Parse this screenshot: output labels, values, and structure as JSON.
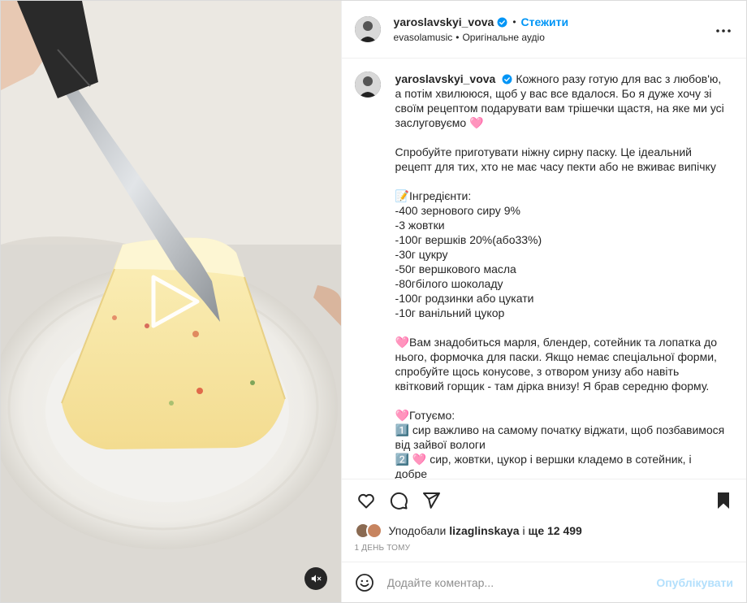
{
  "header": {
    "username": "yaroslavskyi_vova",
    "separator": "•",
    "follow_label": "Стежити",
    "audio_artist": "evasolamusic",
    "audio_separator": "•",
    "audio_label": "Оригінальне аудіо",
    "more_icon": "more-horizontal-icon"
  },
  "caption": {
    "username": "yaroslavskyi_vova",
    "paragraphs": [
      "Кожного разу готую для вас з любов'ю, а потім хвилююся, щоб у вас все вдалося. Бо я дуже хочу зі своїм рецептом подарувати вам трішечки щастя, на яке ми усі заслуговуємо 🩷",
      "Спробуйте приготувати ніжну сирну паску. Це ідеальний рецепт для тих, хто не має часу пекти або не вживає випічку",
      "📝Інгредієнти:\n-400 зернового сиру 9%\n-3 жовтки\n-100г вершків 20%(або33%)\n-30г цукру\n-50г вершкового масла\n-80гбілого шоколаду\n-100г родзинки або цукати\n-10г ванільний цукор",
      "🩷Вам знадобиться марля, блендер, сотейник та лопатка до нього, формочка для паски. Якщо немає спеціальної форми, спробуйте щось конусове, з отвором унизу або навіть квітковий горщик - там дірка внизу! Я брав середню форму.",
      "🩷Готуємо:\n1️⃣ сир важливо на самому початку віджати, щоб позбавимося від зайвої вологи\n2️⃣ 🩷 сир, жовтки, цукор і вершки кладемо в сотейник, і добре"
    ]
  },
  "actions": {
    "like_icon": "heart-icon",
    "comment_icon": "comment-icon",
    "share_icon": "share-icon",
    "save_icon": "bookmark-icon"
  },
  "likes": {
    "prefix": "Уподобали",
    "user": "lizaglinskaya",
    "middle": "і",
    "others": "ще 12 499"
  },
  "timestamp": "1 ДЕНЬ ТОМУ",
  "comment": {
    "placeholder": "Додайте коментар...",
    "post_label": "Опублікувати",
    "emoji_icon": "emoji-icon"
  },
  "media": {
    "play_icon": "play-icon",
    "mute_icon": "muted-speaker-icon"
  },
  "colors": {
    "accent": "#0095f6",
    "post_disabled": "#b2dffc",
    "verified": "#0095f6",
    "muted_text": "#8e8e8e"
  }
}
